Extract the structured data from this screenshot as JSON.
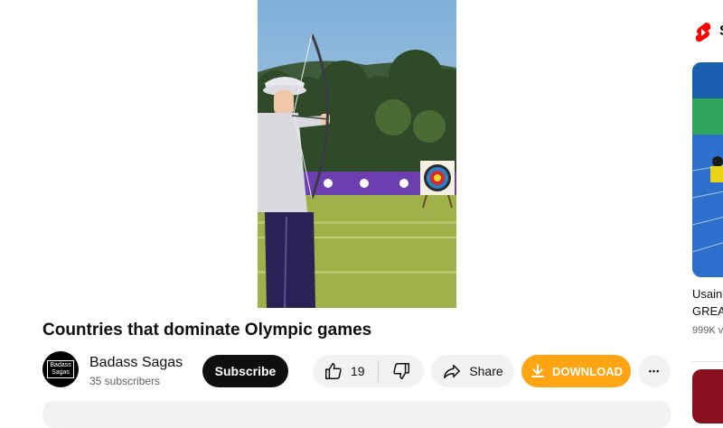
{
  "video": {
    "title": "Countries that dominate Olympic games"
  },
  "channel": {
    "name": "Badass Sagas",
    "subscribers": "35 subscribers",
    "avatar_text_line1": "Badass",
    "avatar_text_line2": "Sagas"
  },
  "actions": {
    "subscribe_label": "Subscribe",
    "like_count": "19",
    "share_label": "Share",
    "download_label": "DOWNLOAD",
    "more_label": "•••"
  },
  "sidebar": {
    "section_label": "S",
    "recommendation": {
      "title_line1": "Usain",
      "title_line2": "GREA",
      "views": "999K v"
    }
  },
  "colors": {
    "download_accent": "#ffa412",
    "shorts_red": "#ff0000",
    "subscribe_bg": "#0f0f0f"
  },
  "icons": [
    "like-icon",
    "dislike-icon",
    "share-icon",
    "download-icon",
    "more-icon",
    "shorts-icon"
  ]
}
